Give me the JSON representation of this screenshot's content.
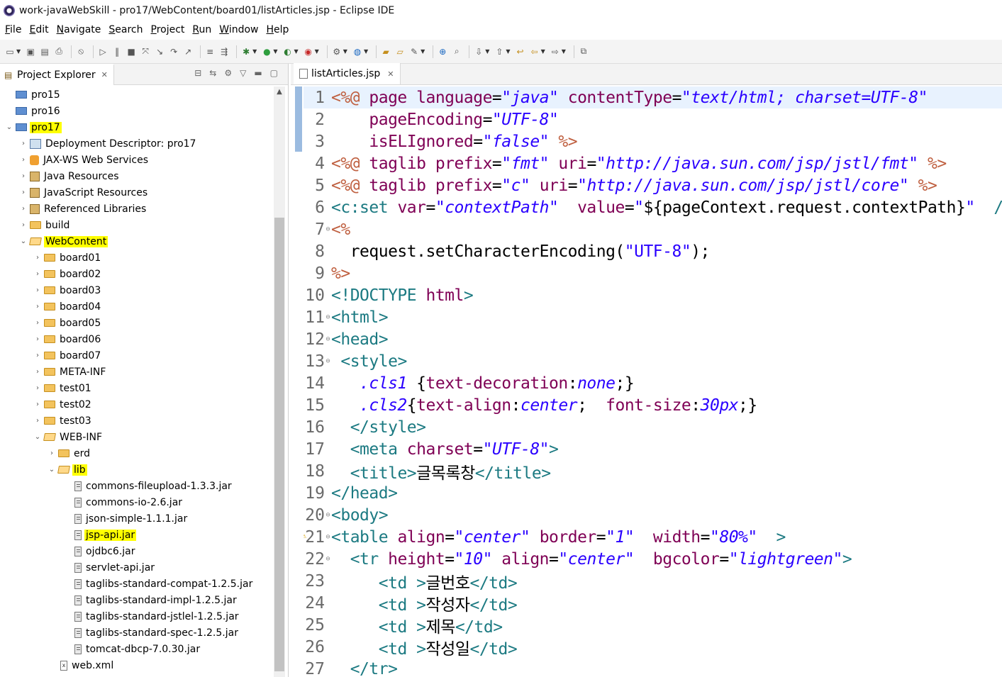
{
  "window": {
    "title": "work-javaWebSkill - pro17/WebContent/board01/listArticles.jsp - Eclipse IDE"
  },
  "menu": [
    "File",
    "Edit",
    "Navigate",
    "Search",
    "Project",
    "Run",
    "Window",
    "Help"
  ],
  "explorer": {
    "tab_label": "Project Explorer",
    "tree": [
      {
        "label": "pro15",
        "icon": "project-icon",
        "depth": 0,
        "expander": "",
        "highlight": false
      },
      {
        "label": "pro16",
        "icon": "project-icon",
        "depth": 0,
        "expander": "",
        "highlight": false
      },
      {
        "label": "pro17",
        "icon": "project-icon",
        "depth": 0,
        "expander": "open",
        "highlight": true
      },
      {
        "label": "Deployment Descriptor: pro17",
        "icon": "deployment-descriptor-icon",
        "depth": 1,
        "expander": "closed",
        "highlight": false
      },
      {
        "label": "JAX-WS Web Services",
        "icon": "web-services-icon",
        "depth": 1,
        "expander": "closed",
        "highlight": false
      },
      {
        "label": "Java Resources",
        "icon": "java-resources-icon",
        "depth": 1,
        "expander": "closed",
        "highlight": false
      },
      {
        "label": "JavaScript Resources",
        "icon": "javascript-resources-icon",
        "depth": 1,
        "expander": "closed",
        "highlight": false
      },
      {
        "label": "Referenced Libraries",
        "icon": "library-icon",
        "depth": 1,
        "expander": "closed",
        "highlight": false
      },
      {
        "label": "build",
        "icon": "folder-icon",
        "depth": 1,
        "expander": "closed",
        "highlight": false
      },
      {
        "label": "WebContent",
        "icon": "open-folder-icon",
        "depth": 1,
        "expander": "open",
        "highlight": true
      },
      {
        "label": "board01",
        "icon": "folder-icon",
        "depth": 2,
        "expander": "closed",
        "highlight": false
      },
      {
        "label": "board02",
        "icon": "folder-icon",
        "depth": 2,
        "expander": "closed",
        "highlight": false
      },
      {
        "label": "board03",
        "icon": "folder-icon",
        "depth": 2,
        "expander": "closed",
        "highlight": false
      },
      {
        "label": "board04",
        "icon": "folder-icon",
        "depth": 2,
        "expander": "closed",
        "highlight": false
      },
      {
        "label": "board05",
        "icon": "folder-icon",
        "depth": 2,
        "expander": "closed",
        "highlight": false
      },
      {
        "label": "board06",
        "icon": "folder-icon",
        "depth": 2,
        "expander": "closed",
        "highlight": false
      },
      {
        "label": "board07",
        "icon": "folder-icon",
        "depth": 2,
        "expander": "closed",
        "highlight": false
      },
      {
        "label": "META-INF",
        "icon": "folder-icon",
        "depth": 2,
        "expander": "closed",
        "highlight": false
      },
      {
        "label": "test01",
        "icon": "folder-icon",
        "depth": 2,
        "expander": "closed",
        "highlight": false
      },
      {
        "label": "test02",
        "icon": "folder-icon",
        "depth": 2,
        "expander": "closed",
        "highlight": false
      },
      {
        "label": "test03",
        "icon": "folder-icon",
        "depth": 2,
        "expander": "closed",
        "highlight": false
      },
      {
        "label": "WEB-INF",
        "icon": "open-folder-icon",
        "depth": 2,
        "expander": "open",
        "highlight": false
      },
      {
        "label": "erd",
        "icon": "folder-icon",
        "depth": 3,
        "expander": "closed",
        "highlight": false
      },
      {
        "label": "lib",
        "icon": "open-folder-icon",
        "depth": 3,
        "expander": "open",
        "highlight": true
      },
      {
        "label": "commons-fileupload-1.3.3.jar",
        "icon": "jar-icon",
        "depth": 4,
        "expander": "",
        "highlight": false
      },
      {
        "label": "commons-io-2.6.jar",
        "icon": "jar-icon",
        "depth": 4,
        "expander": "",
        "highlight": false
      },
      {
        "label": "json-simple-1.1.1.jar",
        "icon": "jar-icon",
        "depth": 4,
        "expander": "",
        "highlight": false
      },
      {
        "label": "jsp-api.jar",
        "icon": "jar-icon",
        "depth": 4,
        "expander": "",
        "highlight": true
      },
      {
        "label": "ojdbc6.jar",
        "icon": "jar-icon",
        "depth": 4,
        "expander": "",
        "highlight": false
      },
      {
        "label": "servlet-api.jar",
        "icon": "jar-icon",
        "depth": 4,
        "expander": "",
        "highlight": false
      },
      {
        "label": "taglibs-standard-compat-1.2.5.jar",
        "icon": "jar-icon",
        "depth": 4,
        "expander": "",
        "highlight": false
      },
      {
        "label": "taglibs-standard-impl-1.2.5.jar",
        "icon": "jar-icon",
        "depth": 4,
        "expander": "",
        "highlight": false
      },
      {
        "label": "taglibs-standard-jstlel-1.2.5.jar",
        "icon": "jar-icon",
        "depth": 4,
        "expander": "",
        "highlight": false
      },
      {
        "label": "taglibs-standard-spec-1.2.5.jar",
        "icon": "jar-icon",
        "depth": 4,
        "expander": "",
        "highlight": false
      },
      {
        "label": "tomcat-dbcp-7.0.30.jar",
        "icon": "jar-icon",
        "depth": 4,
        "expander": "",
        "highlight": false
      },
      {
        "label": "web.xml",
        "icon": "xml-file-icon",
        "depth": 3,
        "expander": "",
        "highlight": false
      }
    ]
  },
  "editor": {
    "tab_label": "listArticles.jsp",
    "lines": [
      {
        "n": "1",
        "fold": "",
        "current": true,
        "warn": false,
        "tokens": [
          [
            "dir",
            "<%@ "
          ],
          [
            "attr",
            "page "
          ],
          [
            "attr",
            "language"
          ],
          [
            "plain",
            "="
          ],
          [
            "val",
            "\"java\""
          ],
          [
            "plain",
            " "
          ],
          [
            "attr",
            "contentType"
          ],
          [
            "plain",
            "="
          ],
          [
            "val",
            "\"text/html; charset=UTF-8\""
          ]
        ]
      },
      {
        "n": "2",
        "fold": "",
        "current": false,
        "warn": false,
        "tokens": [
          [
            "plain",
            "    "
          ],
          [
            "attr",
            "pageEncoding"
          ],
          [
            "plain",
            "="
          ],
          [
            "val",
            "\"UTF-8\""
          ]
        ]
      },
      {
        "n": "3",
        "fold": "",
        "current": false,
        "warn": false,
        "tokens": [
          [
            "plain",
            "    "
          ],
          [
            "attr",
            "isELIgnored"
          ],
          [
            "plain",
            "="
          ],
          [
            "val",
            "\"false\""
          ],
          [
            "plain",
            " "
          ],
          [
            "dir",
            "%>"
          ]
        ]
      },
      {
        "n": "4",
        "fold": "",
        "current": false,
        "warn": false,
        "tokens": [
          [
            "dir",
            "<%@ "
          ],
          [
            "attr",
            "taglib "
          ],
          [
            "attr",
            "prefix"
          ],
          [
            "plain",
            "="
          ],
          [
            "val",
            "\"fmt\""
          ],
          [
            "plain",
            " "
          ],
          [
            "attr",
            "uri"
          ],
          [
            "plain",
            "="
          ],
          [
            "val",
            "\"http://java.sun.com/jsp/jstl/fmt\""
          ],
          [
            "plain",
            " "
          ],
          [
            "dir",
            "%>"
          ]
        ]
      },
      {
        "n": "5",
        "fold": "",
        "current": false,
        "warn": false,
        "tokens": [
          [
            "dir",
            "<%@ "
          ],
          [
            "attr",
            "taglib "
          ],
          [
            "attr",
            "prefix"
          ],
          [
            "plain",
            "="
          ],
          [
            "val",
            "\"c\""
          ],
          [
            "plain",
            " "
          ],
          [
            "attr",
            "uri"
          ],
          [
            "plain",
            "="
          ],
          [
            "val",
            "\"http://java.sun.com/jsp/jstl/core\""
          ],
          [
            "plain",
            " "
          ],
          [
            "dir",
            "%>"
          ]
        ]
      },
      {
        "n": "6",
        "fold": "",
        "current": false,
        "warn": false,
        "tokens": [
          [
            "tag",
            "<c:set "
          ],
          [
            "attr",
            "var"
          ],
          [
            "plain",
            "="
          ],
          [
            "val",
            "\"contextPath\""
          ],
          [
            "plain",
            "  "
          ],
          [
            "attr",
            "value"
          ],
          [
            "plain",
            "="
          ],
          [
            "str",
            "\""
          ],
          [
            "plain",
            "${pageContext.request.contextPath}"
          ],
          [
            "str",
            "\""
          ],
          [
            "plain",
            "  "
          ],
          [
            "tag",
            "/>"
          ]
        ]
      },
      {
        "n": "7",
        "fold": "⊖",
        "current": false,
        "warn": false,
        "tokens": [
          [
            "dir",
            "<%"
          ]
        ]
      },
      {
        "n": "8",
        "fold": "",
        "current": false,
        "warn": false,
        "tokens": [
          [
            "plain",
            "  request.setCharacterEncoding("
          ],
          [
            "str",
            "\"UTF-8\""
          ],
          [
            "plain",
            ");"
          ]
        ]
      },
      {
        "n": "9",
        "fold": "",
        "current": false,
        "warn": false,
        "tokens": [
          [
            "dir",
            "%>"
          ]
        ]
      },
      {
        "n": "10",
        "fold": "",
        "current": false,
        "warn": false,
        "tokens": [
          [
            "tag",
            "<!DOCTYPE "
          ],
          [
            "kw",
            "html"
          ],
          [
            "tag",
            ">"
          ]
        ]
      },
      {
        "n": "11",
        "fold": "⊖",
        "current": false,
        "warn": false,
        "tokens": [
          [
            "tag",
            "<html>"
          ]
        ]
      },
      {
        "n": "12",
        "fold": "⊖",
        "current": false,
        "warn": false,
        "tokens": [
          [
            "tag",
            "<head>"
          ]
        ]
      },
      {
        "n": "13",
        "fold": "⊖",
        "current": false,
        "warn": false,
        "tokens": [
          [
            "plain",
            " "
          ],
          [
            "tag",
            "<style>"
          ]
        ]
      },
      {
        "n": "14",
        "fold": "",
        "current": false,
        "warn": false,
        "tokens": [
          [
            "plain",
            "   "
          ],
          [
            "cssval",
            ".cls1"
          ],
          [
            "plain",
            " {"
          ],
          [
            "cssprop",
            "text-decoration"
          ],
          [
            "plain",
            ":"
          ],
          [
            "cssval",
            "none"
          ],
          [
            "plain",
            ";}"
          ]
        ]
      },
      {
        "n": "15",
        "fold": "",
        "current": false,
        "warn": false,
        "tokens": [
          [
            "plain",
            "   "
          ],
          [
            "cssval",
            ".cls2"
          ],
          [
            "plain",
            "{"
          ],
          [
            "cssprop",
            "text-align"
          ],
          [
            "plain",
            ":"
          ],
          [
            "cssval",
            "center"
          ],
          [
            "plain",
            ";  "
          ],
          [
            "cssprop",
            "font-size"
          ],
          [
            "plain",
            ":"
          ],
          [
            "cssval",
            "30px"
          ],
          [
            "plain",
            ";}"
          ]
        ]
      },
      {
        "n": "16",
        "fold": "",
        "current": false,
        "warn": false,
        "tokens": [
          [
            "plain",
            "  "
          ],
          [
            "tag",
            "</style>"
          ]
        ]
      },
      {
        "n": "17",
        "fold": "",
        "current": false,
        "warn": false,
        "tokens": [
          [
            "plain",
            "  "
          ],
          [
            "tag",
            "<meta "
          ],
          [
            "attr",
            "charset"
          ],
          [
            "plain",
            "="
          ],
          [
            "val",
            "\"UTF-8\""
          ],
          [
            "tag",
            ">"
          ]
        ]
      },
      {
        "n": "18",
        "fold": "",
        "current": false,
        "warn": false,
        "tokens": [
          [
            "plain",
            "  "
          ],
          [
            "tag",
            "<title>"
          ],
          [
            "plain",
            "글목록창"
          ],
          [
            "tag",
            "</title>"
          ]
        ]
      },
      {
        "n": "19",
        "fold": "",
        "current": false,
        "warn": false,
        "tokens": [
          [
            "tag",
            "</head>"
          ]
        ]
      },
      {
        "n": "20",
        "fold": "⊖",
        "current": false,
        "warn": false,
        "tokens": [
          [
            "tag",
            "<body>"
          ]
        ]
      },
      {
        "n": "21",
        "fold": "⊖",
        "current": false,
        "warn": true,
        "tokens": [
          [
            "tag",
            "<table "
          ],
          [
            "attr",
            "align"
          ],
          [
            "plain",
            "="
          ],
          [
            "val",
            "\"center\""
          ],
          [
            "plain",
            " "
          ],
          [
            "attr",
            "border"
          ],
          [
            "plain",
            "="
          ],
          [
            "val",
            "\"1\""
          ],
          [
            "plain",
            "  "
          ],
          [
            "attr",
            "width"
          ],
          [
            "plain",
            "="
          ],
          [
            "val",
            "\"80%\""
          ],
          [
            "plain",
            "  "
          ],
          [
            "tag",
            ">"
          ]
        ]
      },
      {
        "n": "22",
        "fold": "⊖",
        "current": false,
        "warn": false,
        "tokens": [
          [
            "plain",
            "  "
          ],
          [
            "tag",
            "<tr "
          ],
          [
            "attr",
            "height"
          ],
          [
            "plain",
            "="
          ],
          [
            "val",
            "\"10\""
          ],
          [
            "plain",
            " "
          ],
          [
            "attr",
            "align"
          ],
          [
            "plain",
            "="
          ],
          [
            "val",
            "\"center\""
          ],
          [
            "plain",
            "  "
          ],
          [
            "attr",
            "bgcolor"
          ],
          [
            "plain",
            "="
          ],
          [
            "val",
            "\"lightgreen\""
          ],
          [
            "tag",
            ">"
          ]
        ]
      },
      {
        "n": "23",
        "fold": "",
        "current": false,
        "warn": false,
        "tokens": [
          [
            "plain",
            "     "
          ],
          [
            "tag",
            "<td >"
          ],
          [
            "plain",
            "글번호"
          ],
          [
            "tag",
            "</td>"
          ]
        ]
      },
      {
        "n": "24",
        "fold": "",
        "current": false,
        "warn": false,
        "tokens": [
          [
            "plain",
            "     "
          ],
          [
            "tag",
            "<td >"
          ],
          [
            "plain",
            "작성자"
          ],
          [
            "tag",
            "</td>"
          ]
        ]
      },
      {
        "n": "25",
        "fold": "",
        "current": false,
        "warn": false,
        "tokens": [
          [
            "plain",
            "     "
          ],
          [
            "tag",
            "<td >"
          ],
          [
            "plain",
            "제목"
          ],
          [
            "tag",
            "</td>"
          ]
        ]
      },
      {
        "n": "26",
        "fold": "",
        "current": false,
        "warn": false,
        "tokens": [
          [
            "plain",
            "     "
          ],
          [
            "tag",
            "<td >"
          ],
          [
            "plain",
            "작성일"
          ],
          [
            "tag",
            "</td>"
          ]
        ]
      },
      {
        "n": "27",
        "fold": "",
        "current": false,
        "warn": false,
        "tokens": [
          [
            "plain",
            "  "
          ],
          [
            "tag",
            "</tr>"
          ]
        ]
      }
    ]
  },
  "colors": {
    "highlight": "#ffff00",
    "tag": "#1c7a82",
    "attribute": "#7f0055",
    "value": "#2a00ff",
    "directive": "#bf5f3f"
  }
}
